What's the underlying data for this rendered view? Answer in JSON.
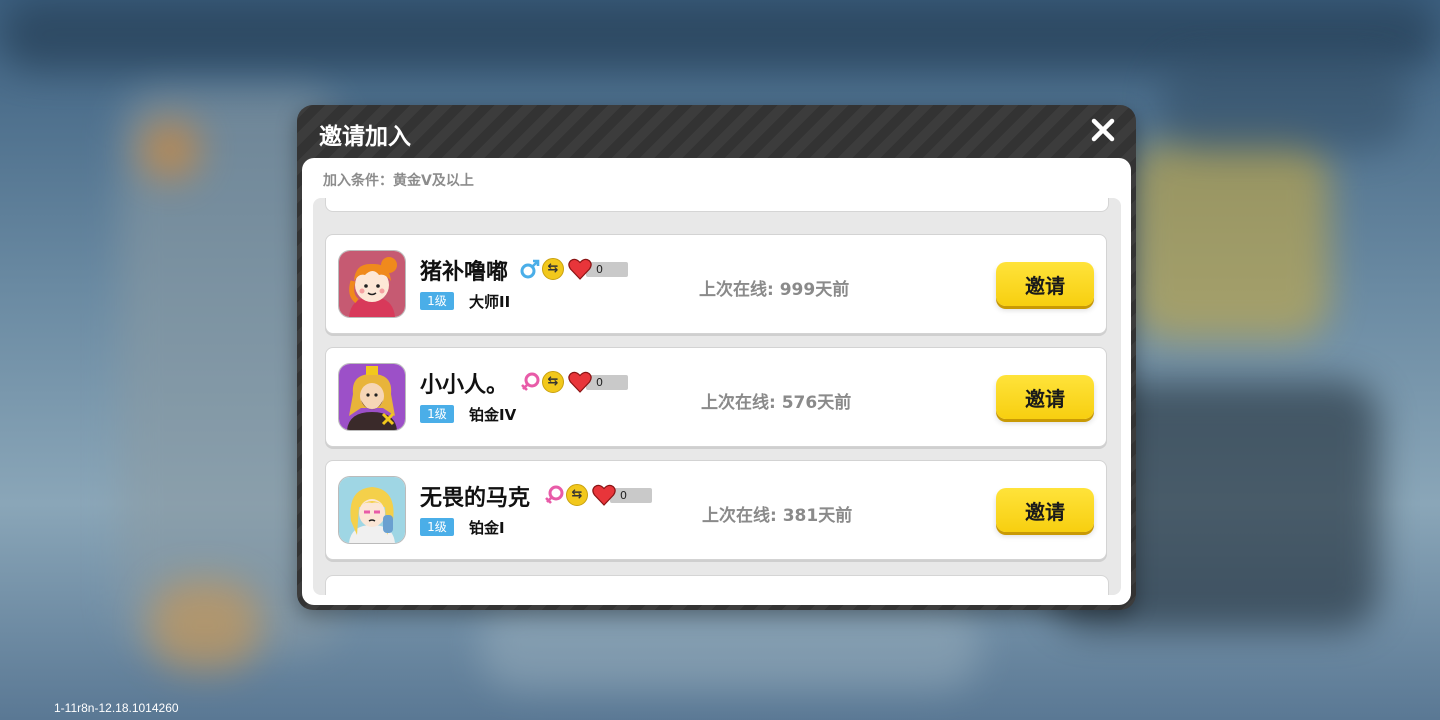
{
  "dialog": {
    "title": "邀请加入",
    "condition": "加入条件：黄金V及以上"
  },
  "build_version": "1-11r8n-12.18.1014260",
  "players": [
    {
      "name": "猪补噜嘟",
      "gender": "male",
      "level": "1级",
      "rank": "大师II",
      "hearts": "0",
      "last_online": "上次在线: 999天前",
      "invite_label": "邀请",
      "avatar_icon": "orange-hair-girl-avatar"
    },
    {
      "name": "小小人。",
      "gender": "female",
      "level": "1级",
      "rank": "铂金IV",
      "hearts": "0",
      "last_online": "上次在线: 576天前",
      "invite_label": "邀请",
      "avatar_icon": "bearded-king-avatar"
    },
    {
      "name": "无畏的马克",
      "gender": "female",
      "level": "1级",
      "rank": "铂金I",
      "hearts": "0",
      "last_online": "上次在线: 381天前",
      "invite_label": "邀请",
      "avatar_icon": "blonde-girl-avatar"
    }
  ],
  "colors": {
    "invite_button": "#f7cf10",
    "level_badge": "#4aaee8",
    "heart": "#e8353a",
    "male": "#4aaee8",
    "female": "#e85ba8"
  }
}
